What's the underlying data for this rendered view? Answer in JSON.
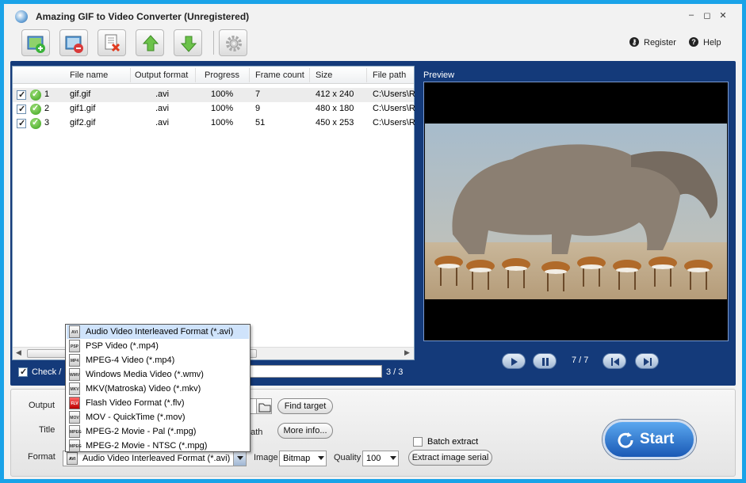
{
  "window": {
    "title": "Amazing GIF to Video Converter (Unregistered)",
    "controls": [
      "–",
      "◻",
      "✕"
    ]
  },
  "header": {
    "register_label": "Register",
    "help_label": "Help"
  },
  "toolbar": {
    "buttons": [
      "add-gif",
      "add-image",
      "remove",
      "move-up",
      "move-down",
      "settings"
    ]
  },
  "table": {
    "columns": [
      "File name",
      "Output format",
      "Progress",
      "Frame count",
      "Size",
      "File path"
    ],
    "rows": [
      {
        "index": "1",
        "file_name": "gif.gif",
        "output_format": ".avi",
        "progress": "100%",
        "frame_count": "7",
        "size": "412 x 240",
        "file_path": "C:\\Users\\R"
      },
      {
        "index": "2",
        "file_name": "gif1.gif",
        "output_format": ".avi",
        "progress": "100%",
        "frame_count": "9",
        "size": "480 x 180",
        "file_path": "C:\\Users\\R"
      },
      {
        "index": "3",
        "file_name": "gif2.gif",
        "output_format": ".avi",
        "progress": "100%",
        "frame_count": "51",
        "size": "450 x 253",
        "file_path": "C:\\Users\\R"
      }
    ]
  },
  "list_footer": {
    "check_all_label": "Check /",
    "count": "3 / 3"
  },
  "preview": {
    "label": "Preview",
    "frames": "7 / 7"
  },
  "bottom": {
    "output_label": "Output",
    "title_label": "Title",
    "format_label": "Format",
    "path_label": "path",
    "find_target_label": "Find target",
    "more_info_label": "More info...",
    "format_value": "Audio Video Interleaved Format (*.avi)",
    "image_label": "Image",
    "image_value": "Bitmap",
    "quality_label": "Quality",
    "quality_value": "100",
    "batch_extract_label": "Batch extract",
    "extract_serial_label": "Extract image serial",
    "start_label": "Start"
  },
  "format_dropdown": {
    "options": [
      {
        "icon": "AVI",
        "label": "Audio Video Interleaved Format (*.avi)"
      },
      {
        "icon": "PSP",
        "label": "PSP Video (*.mp4)"
      },
      {
        "icon": "MP4",
        "label": "MPEG-4 Video (*.mp4)"
      },
      {
        "icon": "WMV",
        "label": "Windows Media Video (*.wmv)"
      },
      {
        "icon": "MKV",
        "label": "MKV(Matroska) Video (*.mkv)"
      },
      {
        "icon": "FLV",
        "label": "Flash Video Format (*.flv)"
      },
      {
        "icon": "MOV",
        "label": "MOV - QuickTime (*.mov)"
      },
      {
        "icon": "MPEG",
        "label": "MPEG-2 Movie - Pal (*.mpg)"
      },
      {
        "icon": "MPEG",
        "label": "MPEG-2 Movie - NTSC (*.mpg)"
      }
    ]
  }
}
